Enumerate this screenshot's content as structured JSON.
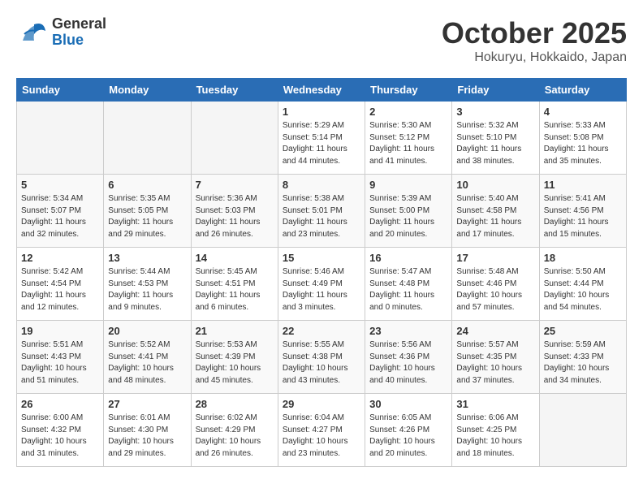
{
  "header": {
    "logo_general": "General",
    "logo_blue": "Blue",
    "month": "October 2025",
    "location": "Hokuryu, Hokkaido, Japan"
  },
  "days_of_week": [
    "Sunday",
    "Monday",
    "Tuesday",
    "Wednesday",
    "Thursday",
    "Friday",
    "Saturday"
  ],
  "weeks": [
    [
      {
        "day": "",
        "empty": true
      },
      {
        "day": "",
        "empty": true
      },
      {
        "day": "",
        "empty": true
      },
      {
        "day": "1",
        "sunrise": "Sunrise: 5:29 AM",
        "sunset": "Sunset: 5:14 PM",
        "daylight": "Daylight: 11 hours and 44 minutes."
      },
      {
        "day": "2",
        "sunrise": "Sunrise: 5:30 AM",
        "sunset": "Sunset: 5:12 PM",
        "daylight": "Daylight: 11 hours and 41 minutes."
      },
      {
        "day": "3",
        "sunrise": "Sunrise: 5:32 AM",
        "sunset": "Sunset: 5:10 PM",
        "daylight": "Daylight: 11 hours and 38 minutes."
      },
      {
        "day": "4",
        "sunrise": "Sunrise: 5:33 AM",
        "sunset": "Sunset: 5:08 PM",
        "daylight": "Daylight: 11 hours and 35 minutes."
      }
    ],
    [
      {
        "day": "5",
        "sunrise": "Sunrise: 5:34 AM",
        "sunset": "Sunset: 5:07 PM",
        "daylight": "Daylight: 11 hours and 32 minutes."
      },
      {
        "day": "6",
        "sunrise": "Sunrise: 5:35 AM",
        "sunset": "Sunset: 5:05 PM",
        "daylight": "Daylight: 11 hours and 29 minutes."
      },
      {
        "day": "7",
        "sunrise": "Sunrise: 5:36 AM",
        "sunset": "Sunset: 5:03 PM",
        "daylight": "Daylight: 11 hours and 26 minutes."
      },
      {
        "day": "8",
        "sunrise": "Sunrise: 5:38 AM",
        "sunset": "Sunset: 5:01 PM",
        "daylight": "Daylight: 11 hours and 23 minutes."
      },
      {
        "day": "9",
        "sunrise": "Sunrise: 5:39 AM",
        "sunset": "Sunset: 5:00 PM",
        "daylight": "Daylight: 11 hours and 20 minutes."
      },
      {
        "day": "10",
        "sunrise": "Sunrise: 5:40 AM",
        "sunset": "Sunset: 4:58 PM",
        "daylight": "Daylight: 11 hours and 17 minutes."
      },
      {
        "day": "11",
        "sunrise": "Sunrise: 5:41 AM",
        "sunset": "Sunset: 4:56 PM",
        "daylight": "Daylight: 11 hours and 15 minutes."
      }
    ],
    [
      {
        "day": "12",
        "sunrise": "Sunrise: 5:42 AM",
        "sunset": "Sunset: 4:54 PM",
        "daylight": "Daylight: 11 hours and 12 minutes."
      },
      {
        "day": "13",
        "sunrise": "Sunrise: 5:44 AM",
        "sunset": "Sunset: 4:53 PM",
        "daylight": "Daylight: 11 hours and 9 minutes."
      },
      {
        "day": "14",
        "sunrise": "Sunrise: 5:45 AM",
        "sunset": "Sunset: 4:51 PM",
        "daylight": "Daylight: 11 hours and 6 minutes."
      },
      {
        "day": "15",
        "sunrise": "Sunrise: 5:46 AM",
        "sunset": "Sunset: 4:49 PM",
        "daylight": "Daylight: 11 hours and 3 minutes."
      },
      {
        "day": "16",
        "sunrise": "Sunrise: 5:47 AM",
        "sunset": "Sunset: 4:48 PM",
        "daylight": "Daylight: 11 hours and 0 minutes."
      },
      {
        "day": "17",
        "sunrise": "Sunrise: 5:48 AM",
        "sunset": "Sunset: 4:46 PM",
        "daylight": "Daylight: 10 hours and 57 minutes."
      },
      {
        "day": "18",
        "sunrise": "Sunrise: 5:50 AM",
        "sunset": "Sunset: 4:44 PM",
        "daylight": "Daylight: 10 hours and 54 minutes."
      }
    ],
    [
      {
        "day": "19",
        "sunrise": "Sunrise: 5:51 AM",
        "sunset": "Sunset: 4:43 PM",
        "daylight": "Daylight: 10 hours and 51 minutes."
      },
      {
        "day": "20",
        "sunrise": "Sunrise: 5:52 AM",
        "sunset": "Sunset: 4:41 PM",
        "daylight": "Daylight: 10 hours and 48 minutes."
      },
      {
        "day": "21",
        "sunrise": "Sunrise: 5:53 AM",
        "sunset": "Sunset: 4:39 PM",
        "daylight": "Daylight: 10 hours and 45 minutes."
      },
      {
        "day": "22",
        "sunrise": "Sunrise: 5:55 AM",
        "sunset": "Sunset: 4:38 PM",
        "daylight": "Daylight: 10 hours and 43 minutes."
      },
      {
        "day": "23",
        "sunrise": "Sunrise: 5:56 AM",
        "sunset": "Sunset: 4:36 PM",
        "daylight": "Daylight: 10 hours and 40 minutes."
      },
      {
        "day": "24",
        "sunrise": "Sunrise: 5:57 AM",
        "sunset": "Sunset: 4:35 PM",
        "daylight": "Daylight: 10 hours and 37 minutes."
      },
      {
        "day": "25",
        "sunrise": "Sunrise: 5:59 AM",
        "sunset": "Sunset: 4:33 PM",
        "daylight": "Daylight: 10 hours and 34 minutes."
      }
    ],
    [
      {
        "day": "26",
        "sunrise": "Sunrise: 6:00 AM",
        "sunset": "Sunset: 4:32 PM",
        "daylight": "Daylight: 10 hours and 31 minutes."
      },
      {
        "day": "27",
        "sunrise": "Sunrise: 6:01 AM",
        "sunset": "Sunset: 4:30 PM",
        "daylight": "Daylight: 10 hours and 29 minutes."
      },
      {
        "day": "28",
        "sunrise": "Sunrise: 6:02 AM",
        "sunset": "Sunset: 4:29 PM",
        "daylight": "Daylight: 10 hours and 26 minutes."
      },
      {
        "day": "29",
        "sunrise": "Sunrise: 6:04 AM",
        "sunset": "Sunset: 4:27 PM",
        "daylight": "Daylight: 10 hours and 23 minutes."
      },
      {
        "day": "30",
        "sunrise": "Sunrise: 6:05 AM",
        "sunset": "Sunset: 4:26 PM",
        "daylight": "Daylight: 10 hours and 20 minutes."
      },
      {
        "day": "31",
        "sunrise": "Sunrise: 6:06 AM",
        "sunset": "Sunset: 4:25 PM",
        "daylight": "Daylight: 10 hours and 18 minutes."
      },
      {
        "day": "",
        "empty": true
      }
    ]
  ]
}
